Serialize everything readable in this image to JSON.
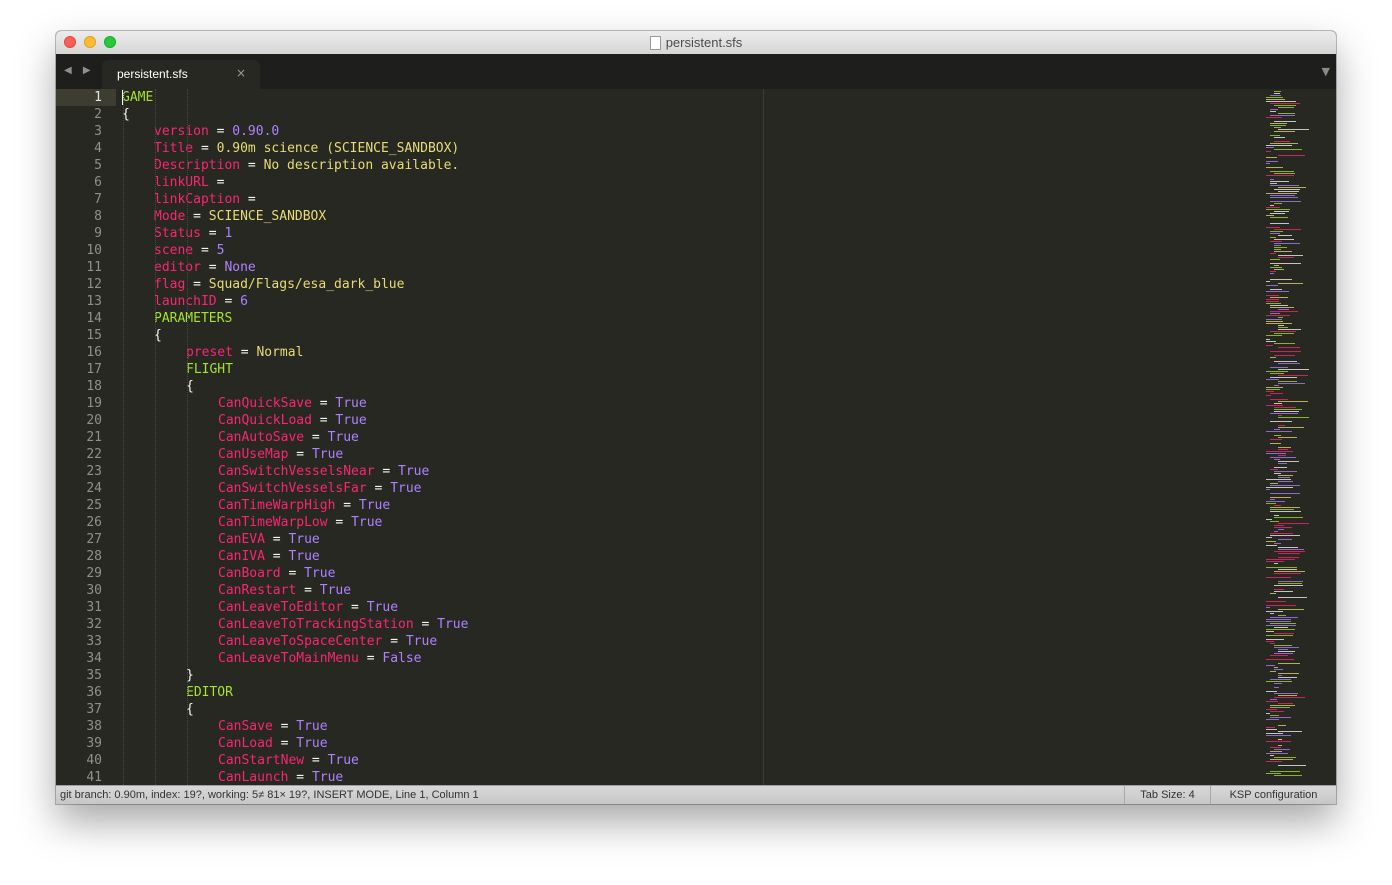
{
  "window": {
    "title": "persistent.sfs",
    "tab_label": "persistent.sfs",
    "tab_close_glyph": "×",
    "nav_glyphs": "◀ ▶",
    "tab_menu_glyph": "▼"
  },
  "colors": {
    "background": "#272822",
    "section": "#a6e22e",
    "key": "#f92672",
    "string": "#e6db74",
    "constant": "#ae81ff",
    "plain": "#f8f8f2"
  },
  "editor": {
    "active_line": 1,
    "lines": [
      {
        "n": "1",
        "indent": 0,
        "tokens": [
          {
            "t": "GAME",
            "c": "section"
          }
        ]
      },
      {
        "n": "2",
        "indent": 0,
        "tokens": [
          {
            "t": "{",
            "c": "brace"
          }
        ]
      },
      {
        "n": "3",
        "indent": 1,
        "tokens": [
          {
            "t": "version",
            "c": "key"
          },
          {
            "t": " = ",
            "c": "op"
          },
          {
            "t": "0.90.0",
            "c": "num"
          }
        ]
      },
      {
        "n": "4",
        "indent": 1,
        "tokens": [
          {
            "t": "Title",
            "c": "key"
          },
          {
            "t": " = ",
            "c": "op"
          },
          {
            "t": "0.90m science (SCIENCE_SANDBOX)",
            "c": "str"
          }
        ]
      },
      {
        "n": "5",
        "indent": 1,
        "tokens": [
          {
            "t": "Description",
            "c": "key"
          },
          {
            "t": " = ",
            "c": "op"
          },
          {
            "t": "No description available.",
            "c": "str"
          }
        ]
      },
      {
        "n": "6",
        "indent": 1,
        "tokens": [
          {
            "t": "linkURL",
            "c": "key"
          },
          {
            "t": " = ",
            "c": "op"
          }
        ]
      },
      {
        "n": "7",
        "indent": 1,
        "tokens": [
          {
            "t": "linkCaption",
            "c": "key"
          },
          {
            "t": " = ",
            "c": "op"
          }
        ]
      },
      {
        "n": "8",
        "indent": 1,
        "tokens": [
          {
            "t": "Mode",
            "c": "key"
          },
          {
            "t": " = ",
            "c": "op"
          },
          {
            "t": "SCIENCE_SANDBOX",
            "c": "str"
          }
        ]
      },
      {
        "n": "9",
        "indent": 1,
        "tokens": [
          {
            "t": "Status",
            "c": "key"
          },
          {
            "t": " = ",
            "c": "op"
          },
          {
            "t": "1",
            "c": "num"
          }
        ]
      },
      {
        "n": "10",
        "indent": 1,
        "tokens": [
          {
            "t": "scene",
            "c": "key"
          },
          {
            "t": " = ",
            "c": "op"
          },
          {
            "t": "5",
            "c": "num"
          }
        ]
      },
      {
        "n": "11",
        "indent": 1,
        "tokens": [
          {
            "t": "editor",
            "c": "key"
          },
          {
            "t": " = ",
            "c": "op"
          },
          {
            "t": "None",
            "c": "num"
          }
        ]
      },
      {
        "n": "12",
        "indent": 1,
        "tokens": [
          {
            "t": "flag",
            "c": "key"
          },
          {
            "t": " = ",
            "c": "op"
          },
          {
            "t": "Squad/Flags/esa_dark_blue",
            "c": "str"
          }
        ]
      },
      {
        "n": "13",
        "indent": 1,
        "tokens": [
          {
            "t": "launchID",
            "c": "key"
          },
          {
            "t": " = ",
            "c": "op"
          },
          {
            "t": "6",
            "c": "num"
          }
        ]
      },
      {
        "n": "14",
        "indent": 1,
        "tokens": [
          {
            "t": "PARAMETERS",
            "c": "section"
          }
        ]
      },
      {
        "n": "15",
        "indent": 1,
        "tokens": [
          {
            "t": "{",
            "c": "brace"
          }
        ]
      },
      {
        "n": "16",
        "indent": 2,
        "tokens": [
          {
            "t": "preset",
            "c": "key"
          },
          {
            "t": " = ",
            "c": "op"
          },
          {
            "t": "Normal",
            "c": "str"
          }
        ]
      },
      {
        "n": "17",
        "indent": 2,
        "tokens": [
          {
            "t": "FLIGHT",
            "c": "section"
          }
        ]
      },
      {
        "n": "18",
        "indent": 2,
        "tokens": [
          {
            "t": "{",
            "c": "brace"
          }
        ]
      },
      {
        "n": "19",
        "indent": 3,
        "tokens": [
          {
            "t": "CanQuickSave",
            "c": "key"
          },
          {
            "t": " = ",
            "c": "op"
          },
          {
            "t": "True",
            "c": "num"
          }
        ]
      },
      {
        "n": "20",
        "indent": 3,
        "tokens": [
          {
            "t": "CanQuickLoad",
            "c": "key"
          },
          {
            "t": " = ",
            "c": "op"
          },
          {
            "t": "True",
            "c": "num"
          }
        ]
      },
      {
        "n": "21",
        "indent": 3,
        "tokens": [
          {
            "t": "CanAutoSave",
            "c": "key"
          },
          {
            "t": " = ",
            "c": "op"
          },
          {
            "t": "True",
            "c": "num"
          }
        ]
      },
      {
        "n": "22",
        "indent": 3,
        "tokens": [
          {
            "t": "CanUseMap",
            "c": "key"
          },
          {
            "t": " = ",
            "c": "op"
          },
          {
            "t": "True",
            "c": "num"
          }
        ]
      },
      {
        "n": "23",
        "indent": 3,
        "tokens": [
          {
            "t": "CanSwitchVesselsNear",
            "c": "key"
          },
          {
            "t": " = ",
            "c": "op"
          },
          {
            "t": "True",
            "c": "num"
          }
        ]
      },
      {
        "n": "24",
        "indent": 3,
        "tokens": [
          {
            "t": "CanSwitchVesselsFar",
            "c": "key"
          },
          {
            "t": " = ",
            "c": "op"
          },
          {
            "t": "True",
            "c": "num"
          }
        ]
      },
      {
        "n": "25",
        "indent": 3,
        "tokens": [
          {
            "t": "CanTimeWarpHigh",
            "c": "key"
          },
          {
            "t": " = ",
            "c": "op"
          },
          {
            "t": "True",
            "c": "num"
          }
        ]
      },
      {
        "n": "26",
        "indent": 3,
        "tokens": [
          {
            "t": "CanTimeWarpLow",
            "c": "key"
          },
          {
            "t": " = ",
            "c": "op"
          },
          {
            "t": "True",
            "c": "num"
          }
        ]
      },
      {
        "n": "27",
        "indent": 3,
        "tokens": [
          {
            "t": "CanEVA",
            "c": "key"
          },
          {
            "t": " = ",
            "c": "op"
          },
          {
            "t": "True",
            "c": "num"
          }
        ]
      },
      {
        "n": "28",
        "indent": 3,
        "tokens": [
          {
            "t": "CanIVA",
            "c": "key"
          },
          {
            "t": " = ",
            "c": "op"
          },
          {
            "t": "True",
            "c": "num"
          }
        ]
      },
      {
        "n": "29",
        "indent": 3,
        "tokens": [
          {
            "t": "CanBoard",
            "c": "key"
          },
          {
            "t": " = ",
            "c": "op"
          },
          {
            "t": "True",
            "c": "num"
          }
        ]
      },
      {
        "n": "30",
        "indent": 3,
        "tokens": [
          {
            "t": "CanRestart",
            "c": "key"
          },
          {
            "t": " = ",
            "c": "op"
          },
          {
            "t": "True",
            "c": "num"
          }
        ]
      },
      {
        "n": "31",
        "indent": 3,
        "tokens": [
          {
            "t": "CanLeaveToEditor",
            "c": "key"
          },
          {
            "t": " = ",
            "c": "op"
          },
          {
            "t": "True",
            "c": "num"
          }
        ]
      },
      {
        "n": "32",
        "indent": 3,
        "tokens": [
          {
            "t": "CanLeaveToTrackingStation",
            "c": "key"
          },
          {
            "t": " = ",
            "c": "op"
          },
          {
            "t": "True",
            "c": "num"
          }
        ]
      },
      {
        "n": "33",
        "indent": 3,
        "tokens": [
          {
            "t": "CanLeaveToSpaceCenter",
            "c": "key"
          },
          {
            "t": " = ",
            "c": "op"
          },
          {
            "t": "True",
            "c": "num"
          }
        ]
      },
      {
        "n": "34",
        "indent": 3,
        "tokens": [
          {
            "t": "CanLeaveToMainMenu",
            "c": "key"
          },
          {
            "t": " = ",
            "c": "op"
          },
          {
            "t": "False",
            "c": "num"
          }
        ]
      },
      {
        "n": "35",
        "indent": 2,
        "tokens": [
          {
            "t": "}",
            "c": "brace"
          }
        ]
      },
      {
        "n": "36",
        "indent": 2,
        "tokens": [
          {
            "t": "EDITOR",
            "c": "section"
          }
        ]
      },
      {
        "n": "37",
        "indent": 2,
        "tokens": [
          {
            "t": "{",
            "c": "brace"
          }
        ]
      },
      {
        "n": "38",
        "indent": 3,
        "tokens": [
          {
            "t": "CanSave",
            "c": "key"
          },
          {
            "t": " = ",
            "c": "op"
          },
          {
            "t": "True",
            "c": "num"
          }
        ]
      },
      {
        "n": "39",
        "indent": 3,
        "tokens": [
          {
            "t": "CanLoad",
            "c": "key"
          },
          {
            "t": " = ",
            "c": "op"
          },
          {
            "t": "True",
            "c": "num"
          }
        ]
      },
      {
        "n": "40",
        "indent": 3,
        "tokens": [
          {
            "t": "CanStartNew",
            "c": "key"
          },
          {
            "t": " = ",
            "c": "op"
          },
          {
            "t": "True",
            "c": "num"
          }
        ]
      },
      {
        "n": "41",
        "indent": 3,
        "tokens": [
          {
            "t": "CanLaunch",
            "c": "key"
          },
          {
            "t": " = ",
            "c": "op"
          },
          {
            "t": "True",
            "c": "num"
          }
        ]
      }
    ]
  },
  "statusbar": {
    "left": "git branch: 0.90m, index: 19?, working: 5≠ 81× 19?, INSERT MODE, Line 1, Column 1",
    "tab_size": "Tab Size: 4",
    "syntax": "KSP configuration"
  }
}
